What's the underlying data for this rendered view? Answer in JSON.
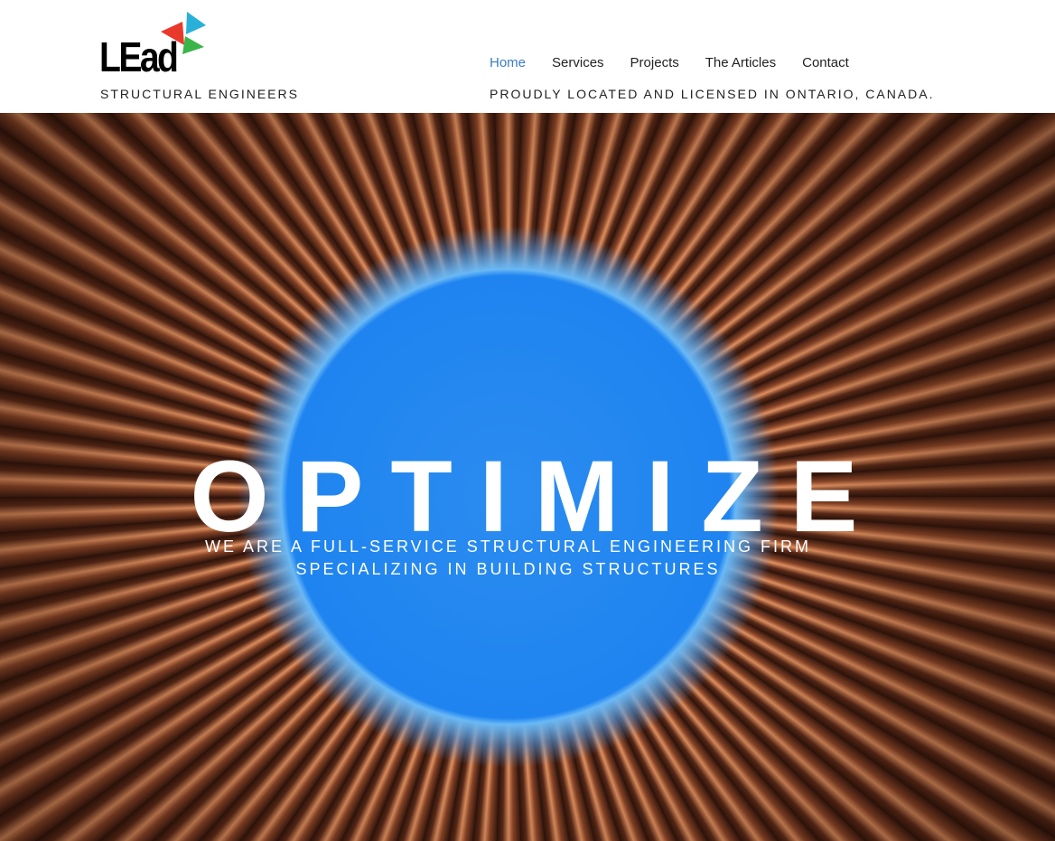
{
  "logo": {
    "text": "LEad",
    "tagline": "STRUCTURAL ENGINEERS"
  },
  "nav": {
    "items": [
      "Home",
      "Services",
      "Projects",
      "The Articles",
      "Contact"
    ],
    "active": "Home"
  },
  "header": {
    "located": "PROUDLY LOCATED AND LICENSED IN ONTARIO, CANADA."
  },
  "hero": {
    "title": "OPTIMIZE",
    "subtitle_line1": "WE ARE A FULL-SERVICE STRUCTURAL ENGINEERING FIRM",
    "subtitle_line2": "SPECIALIZING IN BUILDING STRUCTURES"
  },
  "colors": {
    "accent": "#3b7dc4",
    "red": "#e8392a",
    "cyan": "#29b0d8",
    "green": "#3bb54a"
  }
}
